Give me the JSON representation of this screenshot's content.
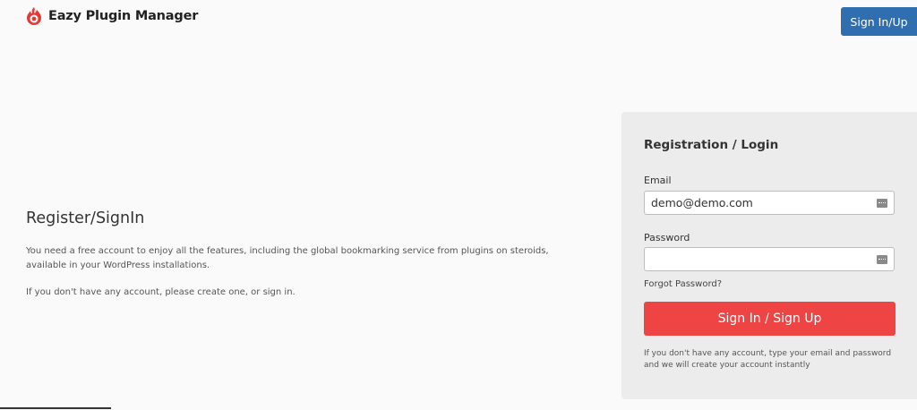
{
  "header": {
    "brand": "Eazy Plugin Manager",
    "signin_button": "Sign In/Up",
    "logo_icon": "flame-logo-icon",
    "brand_color": "#e53935",
    "button_color": "#2f6fb0"
  },
  "intro": {
    "title": "Register/SignIn",
    "paragraph1": "You need a free account to enjoy all the features, including the global bookmarking service from plugins on steroids, available in your WordPress installations.",
    "paragraph2": "If you don't have any account, please create one, or sign in."
  },
  "form": {
    "title": "Registration / Login",
    "email_label": "Email",
    "email_value": "demo@demo.com",
    "password_label": "Password",
    "password_value": "",
    "password_manager_icon": "password-manager-icon",
    "forgot_link": "Forgot Password?",
    "submit_label": "Sign In / Sign Up",
    "submit_color": "#ef4444",
    "note": "If you don't have any account, type your email and password and we will create your account instantly"
  }
}
